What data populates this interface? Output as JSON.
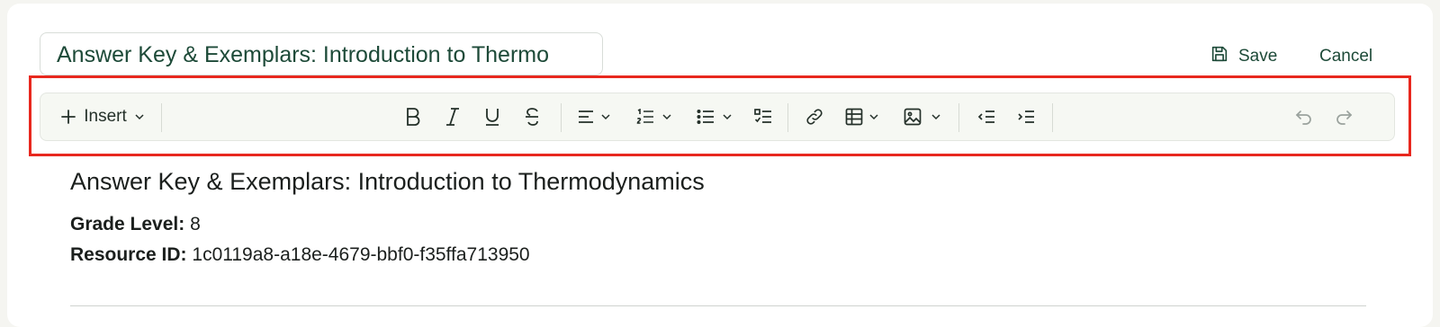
{
  "header": {
    "title_value": "Answer Key & Exemplars: Introduction to Thermo",
    "save_label": "Save",
    "cancel_label": "Cancel"
  },
  "toolbar": {
    "insert_label": "Insert",
    "icons": [
      "plus-icon",
      "chevron-down-icon",
      "bold-icon",
      "italic-icon",
      "underline-icon",
      "strikethrough-icon",
      "align-icon",
      "ordered-list-icon",
      "bullet-list-icon",
      "checklist-icon",
      "link-icon",
      "table-icon",
      "image-icon",
      "outdent-icon",
      "indent-icon",
      "undo-icon",
      "redo-icon"
    ]
  },
  "document": {
    "heading": "Answer Key & Exemplars: Introduction to Thermodynamics",
    "grade_label": "Grade Level:",
    "grade_value": "8",
    "resource_label": "Resource ID:",
    "resource_value": "1c0119a8-a18e-4679-bbf0-f35ffa713950"
  },
  "colors": {
    "accent": "#1d4a38",
    "highlight": "#e8281e",
    "toolbar_bg": "#f6f8f3"
  }
}
